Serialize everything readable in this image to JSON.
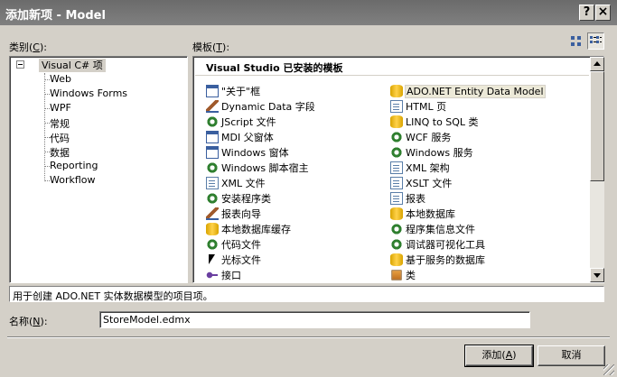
{
  "window": {
    "title": "添加新项 - Model",
    "help_label": "?",
    "close_label": "×"
  },
  "categories": {
    "label_prefix": "类别(",
    "label_key": "C",
    "label_suffix": "):",
    "root": "Visual C# 项",
    "items": [
      "Web",
      "Windows Forms",
      "WPF",
      "常规",
      "代码",
      "数据",
      "Reporting",
      "Workflow"
    ]
  },
  "templates": {
    "label_prefix": "模板(",
    "label_key": "T",
    "label_suffix": "):",
    "section_header": "Visual Studio 已安装的模板",
    "left_column": [
      {
        "label": "\"关于\"框",
        "icon": "window-icon"
      },
      {
        "label": "Dynamic Data 字段",
        "icon": "pen-icon"
      },
      {
        "label": "JScript 文件",
        "icon": "gear-icon"
      },
      {
        "label": "MDI 父窗体",
        "icon": "window-icon"
      },
      {
        "label": "Windows 窗体",
        "icon": "window-icon"
      },
      {
        "label": "Windows 脚本宿主",
        "icon": "gear-icon"
      },
      {
        "label": "XML 文件",
        "icon": "document-icon"
      },
      {
        "label": "安装程序类",
        "icon": "gear-icon"
      },
      {
        "label": "报表向导",
        "icon": "pen-icon"
      },
      {
        "label": "本地数据库缓存",
        "icon": "database-icon"
      },
      {
        "label": "代码文件",
        "icon": "gear-icon"
      },
      {
        "label": "光标文件",
        "icon": "cursor-icon"
      },
      {
        "label": "接口",
        "icon": "interface-icon"
      }
    ],
    "right_column": [
      {
        "label": "ADO.NET Entity Data Model",
        "icon": "database-icon",
        "selected": true
      },
      {
        "label": "HTML 页",
        "icon": "document-icon"
      },
      {
        "label": "LINQ to SQL 类",
        "icon": "database-icon"
      },
      {
        "label": "WCF 服务",
        "icon": "gear-icon"
      },
      {
        "label": "Windows 服务",
        "icon": "gear-icon"
      },
      {
        "label": "XML 架构",
        "icon": "document-icon"
      },
      {
        "label": "XSLT 文件",
        "icon": "document-icon"
      },
      {
        "label": "报表",
        "icon": "document-icon"
      },
      {
        "label": "本地数据库",
        "icon": "database-icon"
      },
      {
        "label": "程序集信息文件",
        "icon": "gear-icon"
      },
      {
        "label": "调试器可视化工具",
        "icon": "gear-icon"
      },
      {
        "label": "基于服务的数据库",
        "icon": "database-icon"
      },
      {
        "label": "类",
        "icon": "class-icon"
      }
    ]
  },
  "description": "用于创建 ADO.NET 实体数据模型的项目项。",
  "name_field": {
    "label_prefix": "名称(",
    "label_key": "N",
    "label_suffix": "):",
    "value": "StoreModel.edmx"
  },
  "buttons": {
    "add_prefix": "添加(",
    "add_key": "A",
    "add_suffix": ")",
    "cancel": "取消"
  }
}
